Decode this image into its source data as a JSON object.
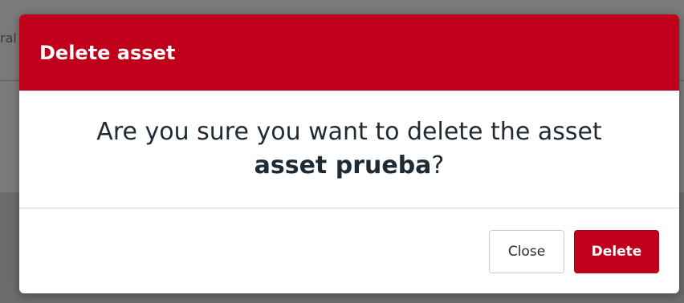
{
  "background": {
    "partial_text": "ral"
  },
  "modal": {
    "title": "Delete asset",
    "message_prefix": "Are you sure you want to delete the asset",
    "asset_name": "asset prueba",
    "message_suffix": "?",
    "close_label": "Close",
    "delete_label": "Delete"
  },
  "colors": {
    "accent": "#c0001a",
    "text": "#1f2a33"
  }
}
